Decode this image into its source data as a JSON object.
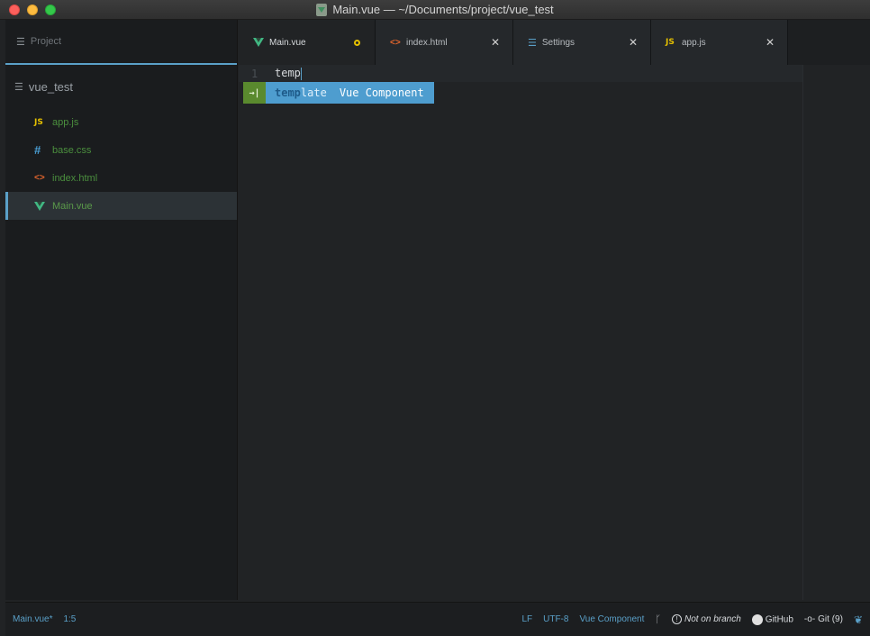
{
  "window": {
    "title": "Main.vue — ~/Documents/project/vue_test"
  },
  "sidebar": {
    "header": "Project",
    "root": "vue_test",
    "files": [
      {
        "icon": "JS",
        "label": "app.js"
      },
      {
        "icon": "#",
        "label": "base.css"
      },
      {
        "icon": "<>",
        "label": "index.html"
      },
      {
        "icon": "vue-icon",
        "label": "Main.vue"
      }
    ]
  },
  "tabs": [
    {
      "label": "Main.vue",
      "icon": "vue-icon",
      "state": "modified"
    },
    {
      "label": "index.html",
      "icon": "<>",
      "state": "close"
    },
    {
      "label": "Settings",
      "icon": "settings-icon",
      "state": "close"
    },
    {
      "label": "app.js",
      "icon": "JS",
      "state": "close"
    }
  ],
  "editor": {
    "line_number": "1",
    "code": "temp",
    "autocomplete": {
      "icon": "→|",
      "match": "temp",
      "rest": "late",
      "type": "Vue Component"
    }
  },
  "statusbar": {
    "file": "Main.vue*",
    "position": "1:5",
    "line_ending": "LF",
    "encoding": "UTF-8",
    "grammar": "Vue Component",
    "branch_status": "Not on branch",
    "github": "GitHub",
    "git": "Git (9)"
  },
  "colors": {
    "accent": "#5aa0c8",
    "vue_green": "#41b883",
    "js_yellow": "#e5c000",
    "file_green": "#4b8f3e"
  }
}
